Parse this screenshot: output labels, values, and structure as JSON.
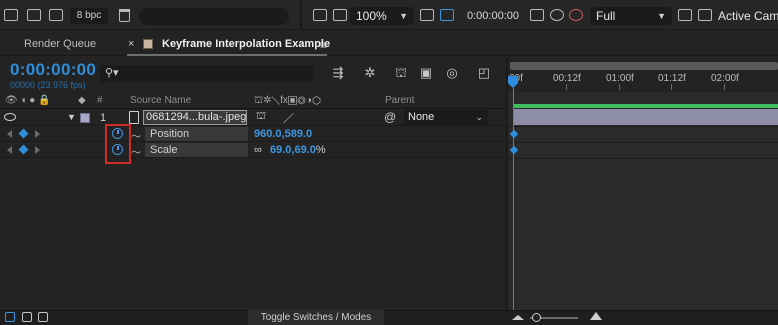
{
  "toolbar": {
    "bit_depth": "8 bpc",
    "zoom_level": "100%",
    "timecode_small": "0:00:00:00",
    "resolution": "Full",
    "active_camera": "Active Cam"
  },
  "tabs": [
    {
      "label": "Render Queue"
    },
    {
      "label": "Keyframe Interpolation Example"
    }
  ],
  "timeline": {
    "timecode": "0:00:00:00",
    "frames_fps": "00000 (23.976 fps)",
    "search_placeholder": "",
    "ruler_labels": [
      "00f",
      "00:12f",
      "01:00f",
      "01:12f",
      "02:00f"
    ]
  },
  "columns": {
    "number": "#",
    "source_name": "Source Name",
    "parent": "Parent"
  },
  "layer": {
    "number": "1",
    "source_name": "0681294...bula-.jpeg",
    "parent": "None",
    "label_color": "#a7a6c7"
  },
  "properties": [
    {
      "name": "Position",
      "value": "960.0,589.0"
    },
    {
      "name": "Scale",
      "value": "69.0,69.0",
      "unit": "%"
    }
  ],
  "bottom": {
    "toggle_label": "Toggle Switches / Modes"
  },
  "colors": {
    "accent": "#2f8de0",
    "comp_bar": "#3fbf5f",
    "layer_bar": "#8e8da8",
    "highlight": "#d32b2b"
  }
}
